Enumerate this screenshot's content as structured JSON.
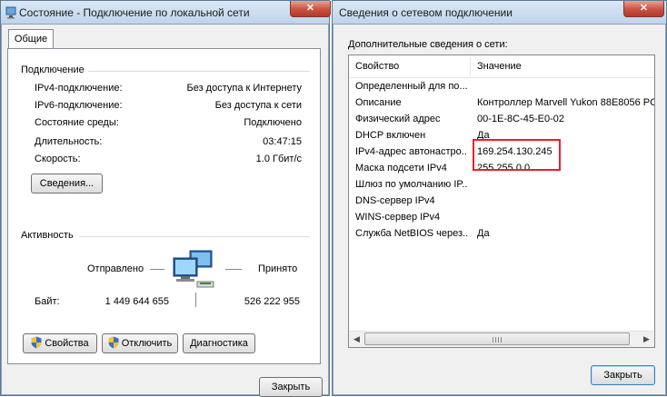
{
  "left": {
    "title": "Состояние - Подключение по локальной сети",
    "tab": "Общие",
    "connection": {
      "heading": "Подключение",
      "rows": [
        {
          "label": "IPv4-подключение:",
          "value": "Без доступа к Интернету"
        },
        {
          "label": "IPv6-подключение:",
          "value": "Без доступа к сети"
        },
        {
          "label": "Состояние среды:",
          "value": "Подключено"
        },
        {
          "label": "Длительность:",
          "value": "03:47:15"
        },
        {
          "label": "Скорость:",
          "value": "1.0 Гбит/с"
        }
      ],
      "details_button": "Сведения..."
    },
    "activity": {
      "heading": "Активность",
      "sent_label": "Отправлено",
      "received_label": "Принято",
      "bytes_label": "Байт:",
      "bytes_sent": "1 449 644 655",
      "bytes_received": "526 222 955"
    },
    "buttons": {
      "properties": "Свойства",
      "disable": "Отключить",
      "diagnose": "Диагностика"
    },
    "close_button": "Закрыть"
  },
  "right": {
    "title": "Сведения о сетевом подключении",
    "subtitle": "Дополнительные сведения о сети:",
    "columns": {
      "property": "Свойство",
      "value": "Значение"
    },
    "rows": [
      {
        "property": "Определенный для по...",
        "value": ""
      },
      {
        "property": "Описание",
        "value": "Контроллер Marvell Yukon 88E8056 PC"
      },
      {
        "property": "Физический адрес",
        "value": "00-1E-8C-45-E0-02"
      },
      {
        "property": "DHCP включен",
        "value": "Да"
      },
      {
        "property": "IPv4-адрес автонастро...",
        "value": "169.254.130.245"
      },
      {
        "property": "Маска подсети IPv4",
        "value": "255.255.0.0"
      },
      {
        "property": "Шлюз по умолчанию IP...",
        "value": ""
      },
      {
        "property": "DNS-сервер IPv4",
        "value": ""
      },
      {
        "property": "WINS-сервер IPv4",
        "value": ""
      },
      {
        "property": "Служба NetBIOS через...",
        "value": "Да"
      }
    ],
    "close_button": "Закрыть"
  },
  "icons": {
    "window": "network-adapter-icon",
    "close": "close-icon",
    "shield": "uac-shield-icon",
    "activity": "computer-network-activity-icon"
  },
  "colors": {
    "highlight_box": "#e8212b",
    "close_button": "#c8523f",
    "title_bar": "#bed3ea",
    "dialog_bg": "#f0f0f0"
  }
}
